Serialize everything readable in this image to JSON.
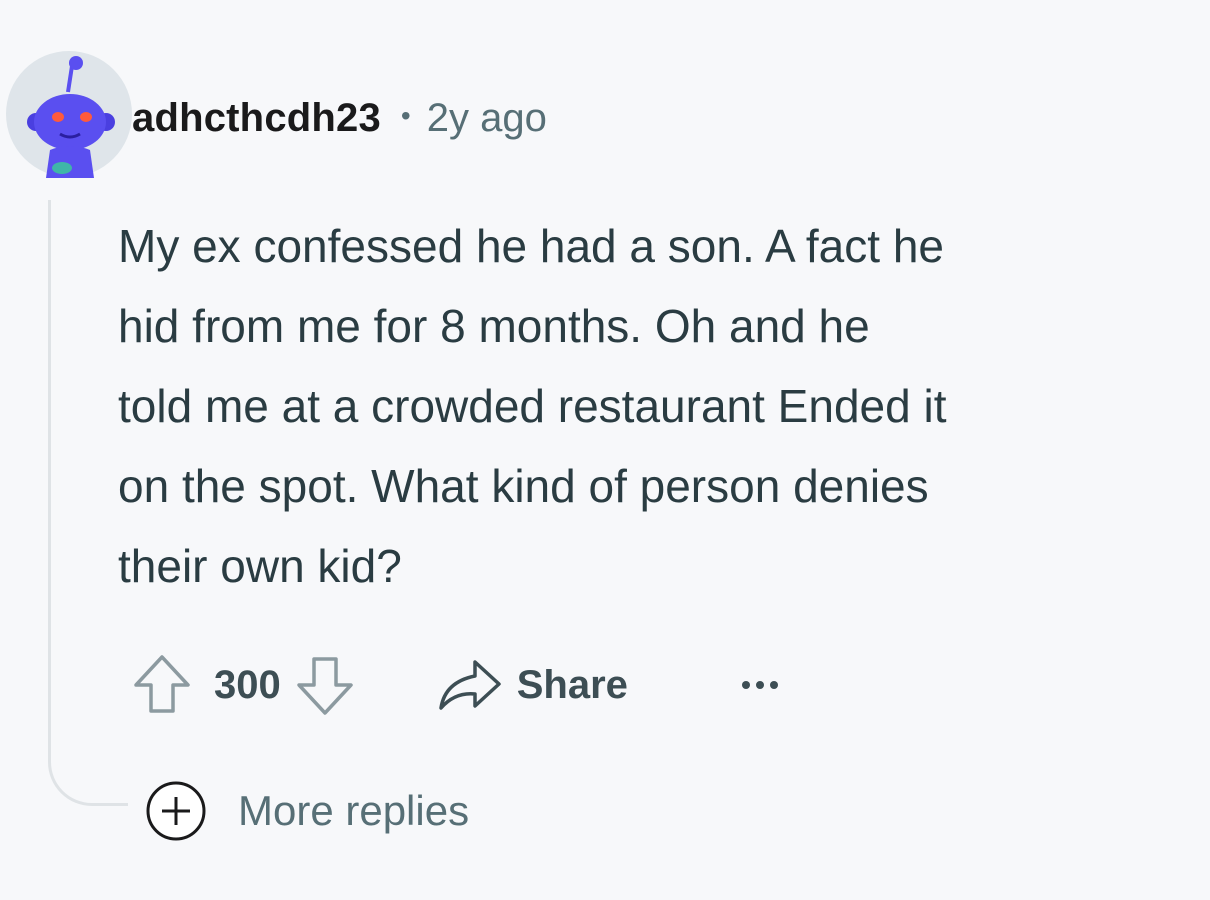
{
  "comment": {
    "username": "adhcthcdh23",
    "separator": "•",
    "timestamp": "2y ago",
    "body_lines": [
      "My ex confessed he had a son. A fact he",
      "hid from me for 8 months. Oh and he",
      "told me at a crowded restaurant Ended it",
      "on the spot. What kind of person denies",
      "their own kid?"
    ]
  },
  "actions": {
    "score": "300",
    "share_label": "Share",
    "upvote_icon": "upvote-arrow-icon",
    "downvote_icon": "downvote-arrow-icon",
    "share_icon": "share-arrow-icon",
    "more_icon": "overflow-dots-icon"
  },
  "more_replies": {
    "label": "More replies",
    "icon": "plus-circle-icon"
  },
  "colors": {
    "background": "#f7f8fa",
    "avatar_bg": "#dfe5ea",
    "avatar_body": "#5a4ff0",
    "muted_text": "#576f76",
    "body_text": "#2a3c42"
  }
}
